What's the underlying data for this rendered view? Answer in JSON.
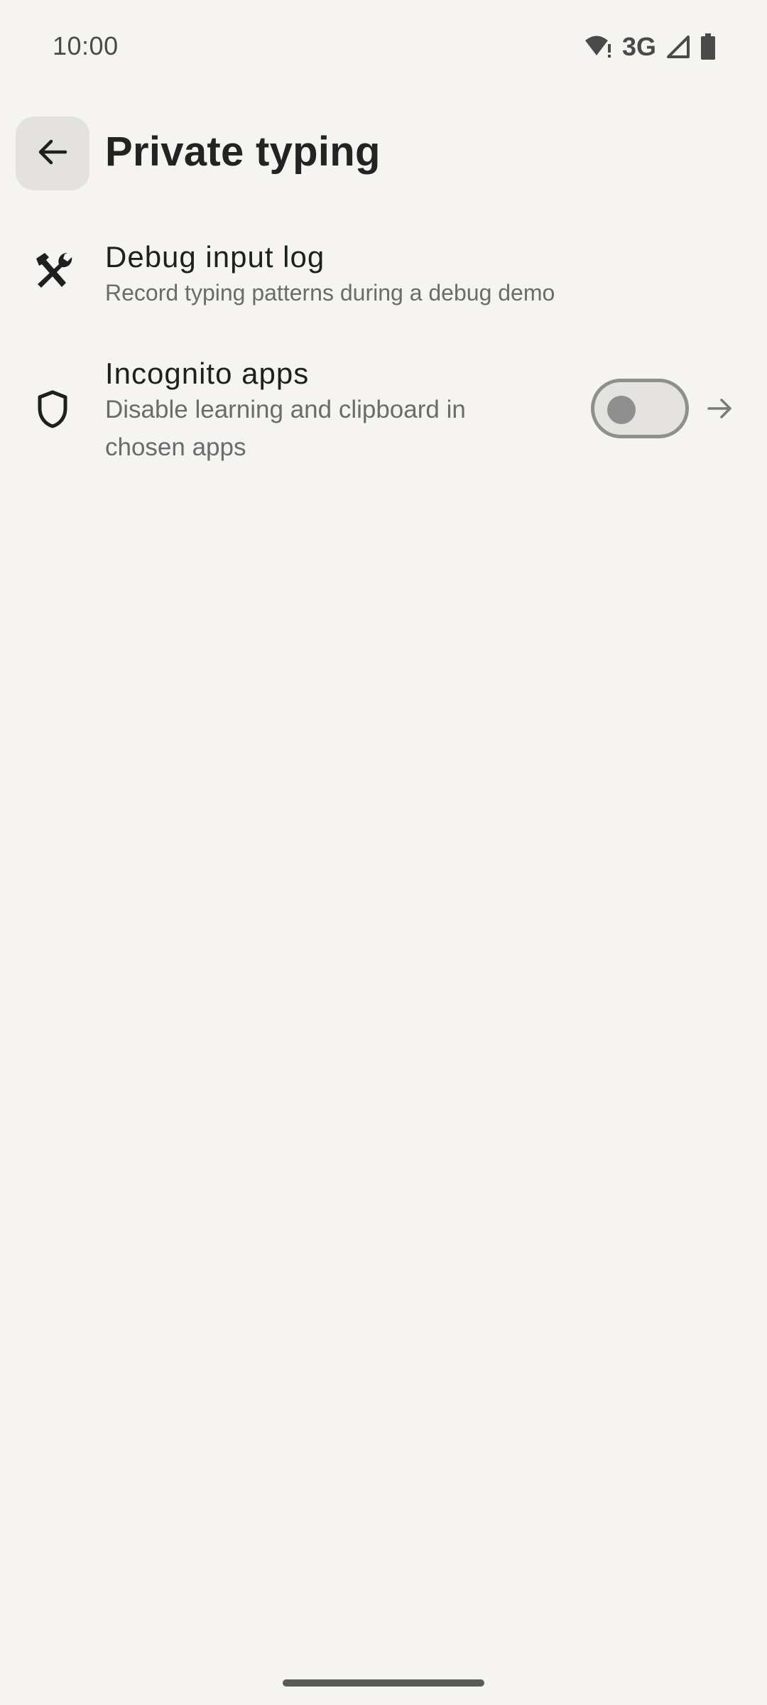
{
  "status_bar": {
    "time": "10:00",
    "network": "3G",
    "icons": [
      "wifi-alert-icon",
      "cell-signal-icon",
      "battery-icon"
    ]
  },
  "app_bar": {
    "back_icon": "arrow-left-icon",
    "title": "Private typing"
  },
  "settings": [
    {
      "icon": "tools-icon",
      "title": "Debug input log",
      "summary": "Record typing patterns during a debug demo"
    },
    {
      "icon": "shield-icon",
      "title": "Incognito apps",
      "summary_line1": "Disable learning and clipboard in",
      "summary_line2": "chosen apps",
      "toggle_on": false,
      "chevron_icon": "arrow-right-icon"
    }
  ],
  "colors": {
    "background": "#f5f4f1",
    "back_button_bg": "#e3e2de",
    "toggle_track": "#e4e3df",
    "toggle_outline": "#8f8f8f"
  }
}
